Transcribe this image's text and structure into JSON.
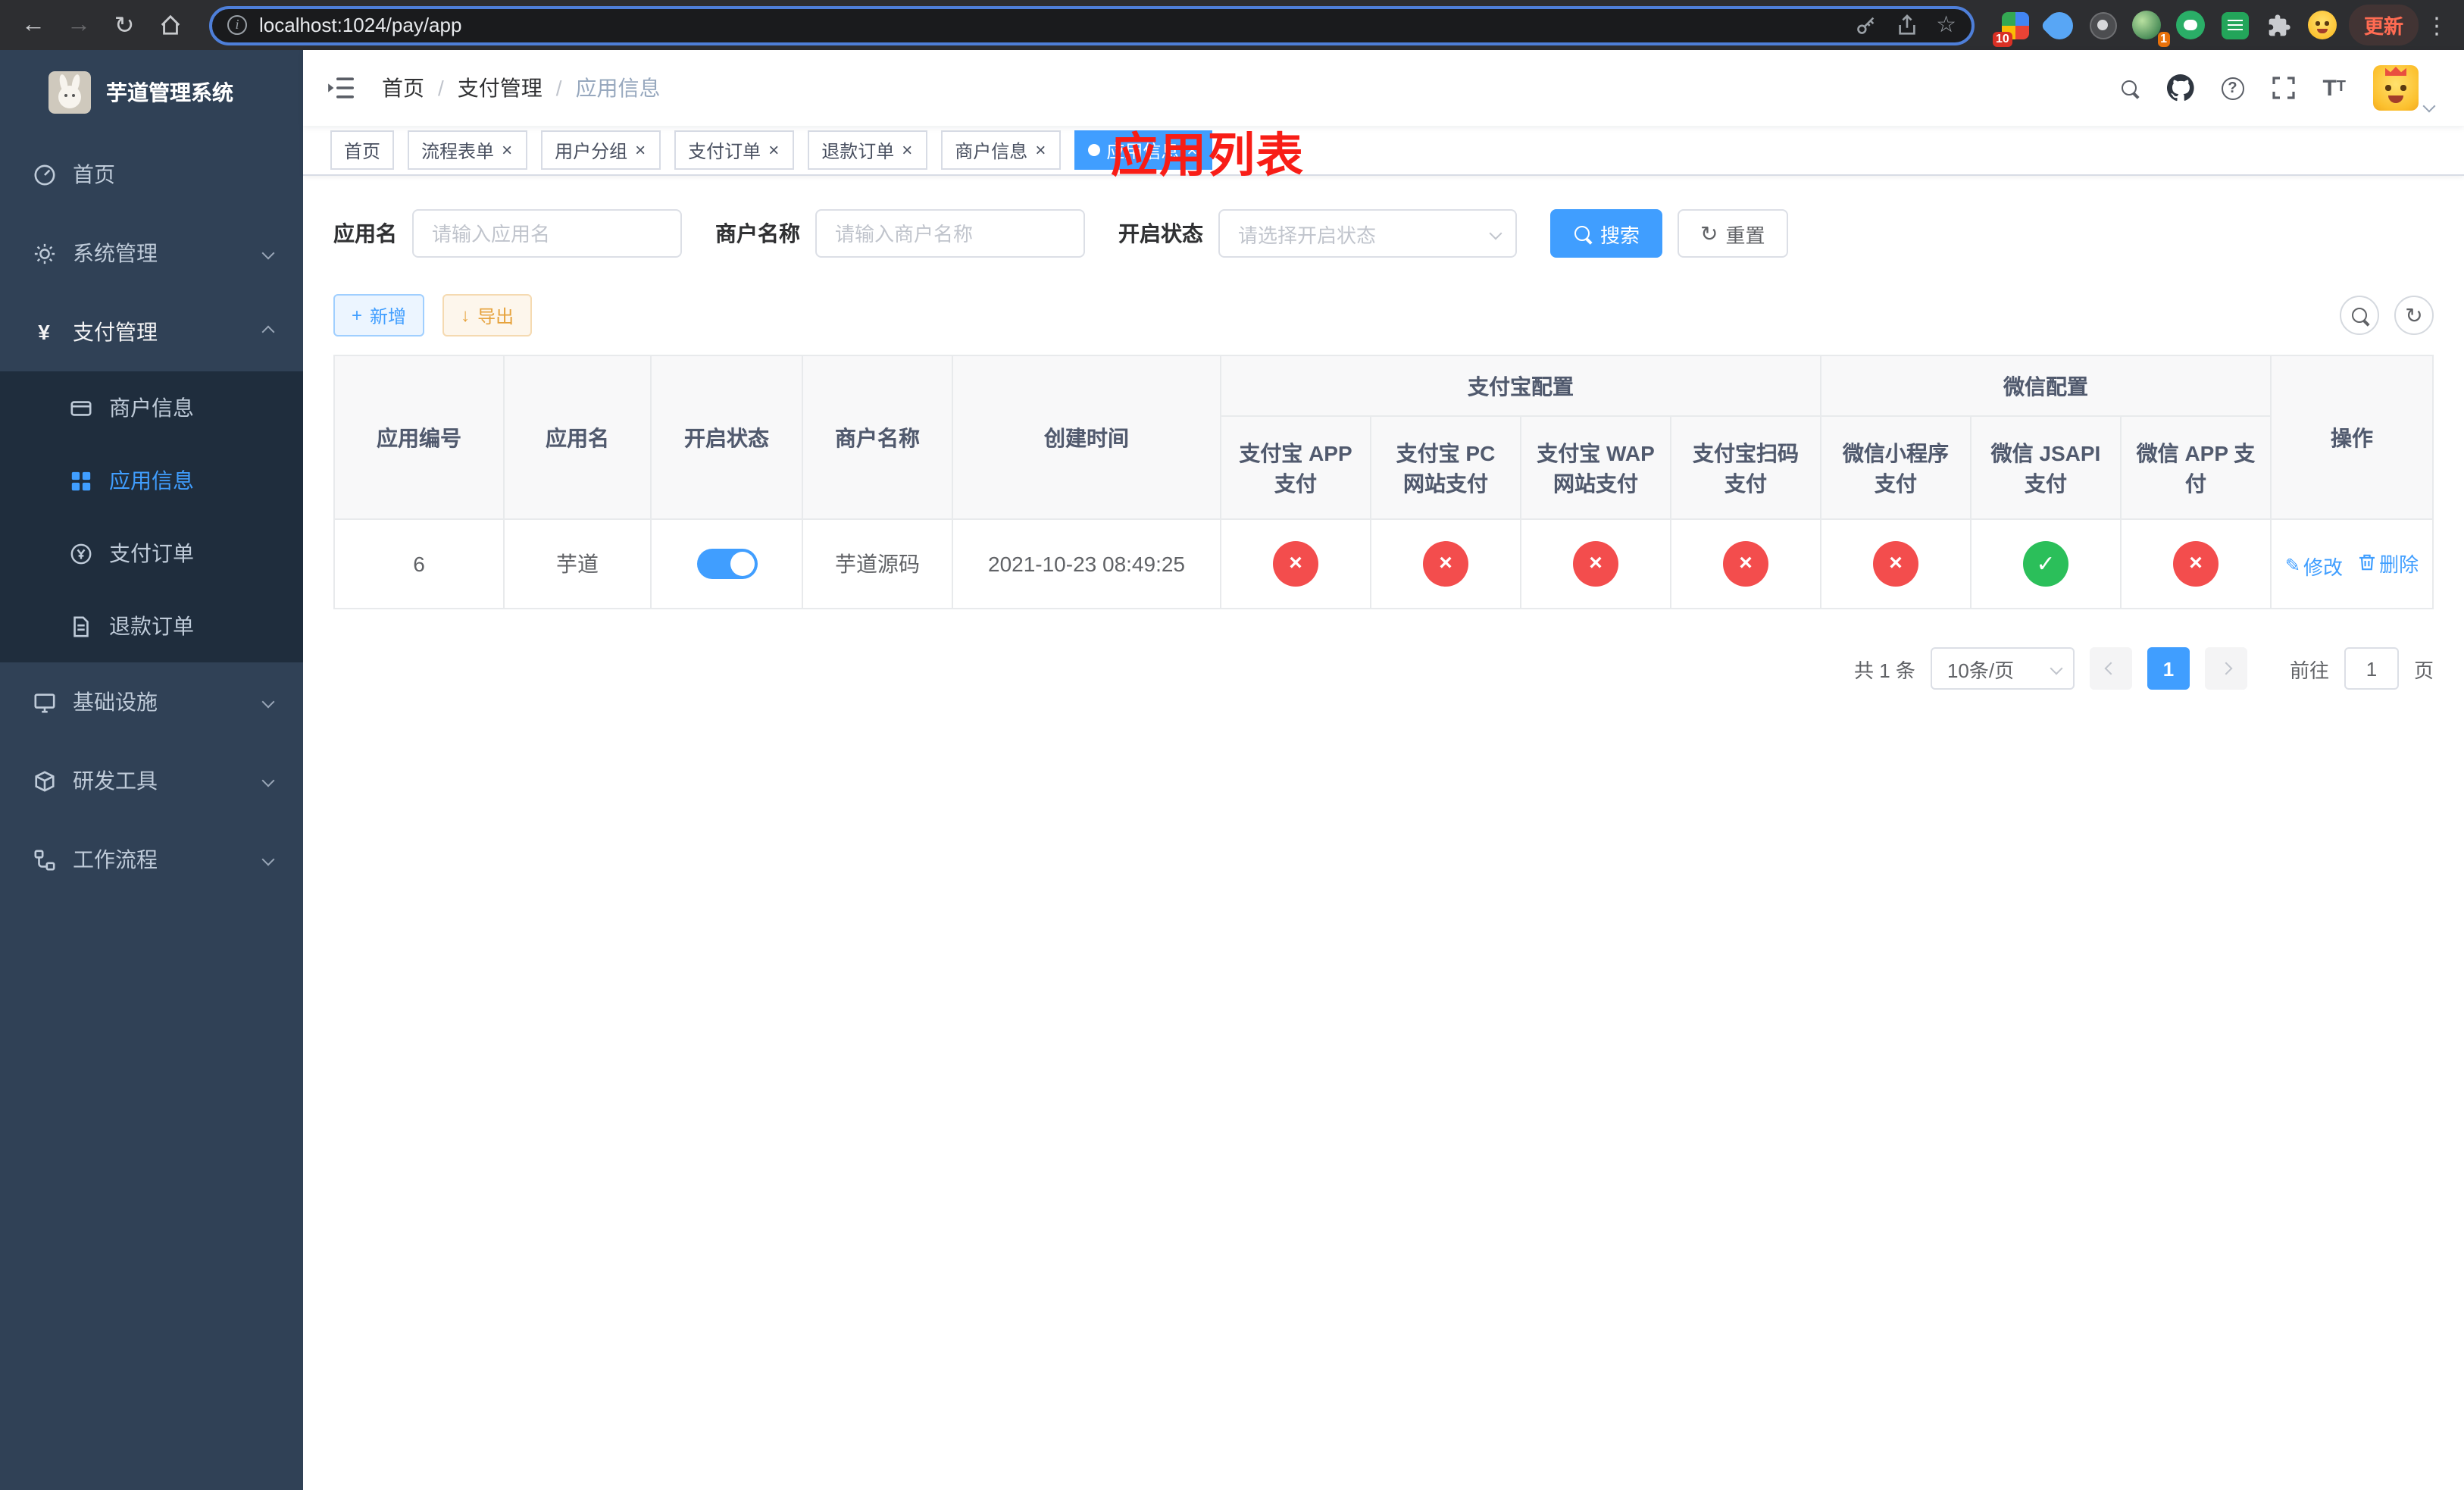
{
  "browser": {
    "url": "localhost:1024/pay/app",
    "update_label": "更新",
    "badge_first": "10",
    "badge_second": "1"
  },
  "sidebar": {
    "title": "芋道管理系统",
    "menu": [
      {
        "label": "首页"
      },
      {
        "label": "系统管理"
      },
      {
        "label": "支付管理"
      },
      {
        "label": "基础设施"
      },
      {
        "label": "研发工具"
      },
      {
        "label": "工作流程"
      }
    ],
    "submenu": [
      {
        "label": "商户信息"
      },
      {
        "label": "应用信息"
      },
      {
        "label": "支付订单"
      },
      {
        "label": "退款订单"
      }
    ]
  },
  "header": {
    "breadcrumb": {
      "home": "首页",
      "section": "支付管理",
      "page": "应用信息"
    },
    "annotation": "应用列表"
  },
  "tabs": [
    {
      "label": "首页"
    },
    {
      "label": "流程表单"
    },
    {
      "label": "用户分组"
    },
    {
      "label": "支付订单"
    },
    {
      "label": "退款订单"
    },
    {
      "label": "商户信息"
    },
    {
      "label": "应用信息"
    }
  ],
  "filters": {
    "app_name_label": "应用名",
    "app_name_placeholder": "请输入应用名",
    "merchant_label": "商户名称",
    "merchant_placeholder": "请输入商户名称",
    "status_label": "开启状态",
    "status_placeholder": "请选择开启状态",
    "search_label": "搜索",
    "reset_label": "重置"
  },
  "toolbar": {
    "add_label": "新增",
    "export_label": "导出"
  },
  "table": {
    "headers": {
      "app_id": "应用编号",
      "app_name": "应用名",
      "status": "开启状态",
      "merchant": "商户名称",
      "created": "创建时间",
      "alipay_group": "支付宝配置",
      "wechat_group": "微信配置",
      "alipay_app": "支付宝 APP 支付",
      "alipay_pc": "支付宝 PC 网站支付",
      "alipay_wap": "支付宝 WAP 网站支付",
      "alipay_qr": "支付宝扫码支付",
      "wechat_mini": "微信小程序支付",
      "wechat_jsapi": "微信 JSAPI 支付",
      "wechat_app": "微信 APP 支付",
      "actions": "操作"
    },
    "row": {
      "app_id": "6",
      "app_name": "芋道",
      "merchant": "芋道源码",
      "created": "2021-10-23 08:49:25",
      "alipay_app": "no",
      "alipay_pc": "no",
      "alipay_wap": "no",
      "alipay_qr": "no",
      "wechat_mini": "no",
      "wechat_jsapi": "ok",
      "wechat_app": "no",
      "edit_label": "修改",
      "delete_label": "删除"
    }
  },
  "pagination": {
    "total_text": "共 1 条",
    "page_size": "10条/页",
    "current_page": "1",
    "goto_label": "前往",
    "goto_value": "1",
    "page_label": "页"
  }
}
